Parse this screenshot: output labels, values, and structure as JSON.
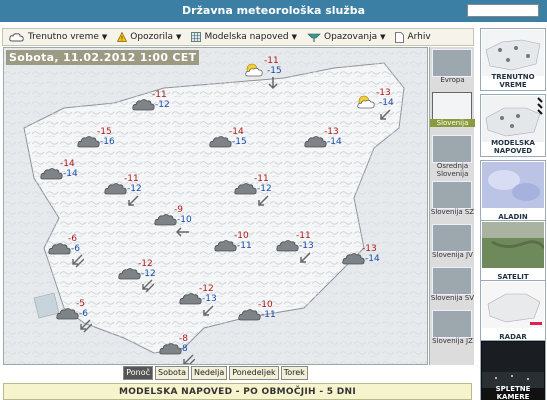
{
  "header": {
    "title": "Državna meteorološka služba",
    "colors": {
      "bar": "#3c7fa5",
      "text": "#ffffff"
    }
  },
  "menu": {
    "items": [
      {
        "label": "Trenutno vreme",
        "icon": "cloud-outline-icon",
        "has_caret": true
      },
      {
        "label": "Opozorila",
        "icon": "warning-triangle-icon",
        "has_caret": true
      },
      {
        "label": "Modelska napoved",
        "icon": "grid-icon",
        "has_caret": true
      },
      {
        "label": "Opazovanja",
        "icon": "observation-station-icon",
        "has_caret": true
      },
      {
        "label": "Arhiv",
        "icon": "document-icon",
        "has_caret": false
      }
    ]
  },
  "map": {
    "date_label": "Sobota, 11.02.2012 1:00 CET",
    "stations": [
      {
        "name": "s1",
        "icon": "partly-cloudy-night-icon",
        "tmax": "-11",
        "tmin": "-15",
        "wind": "south"
      },
      {
        "name": "s2",
        "icon": "cloudy-icon",
        "tmax": "-11",
        "tmin": "-12",
        "wind": ""
      },
      {
        "name": "s3",
        "icon": "partly-cloudy-night-icon",
        "tmax": "-13",
        "tmin": "-14",
        "wind": "southwest"
      },
      {
        "name": "s4",
        "icon": "cloudy-icon",
        "tmax": "-15",
        "tmin": "-16",
        "wind": ""
      },
      {
        "name": "s5",
        "icon": "cloudy-icon",
        "tmax": "-14",
        "tmin": "-15",
        "wind": ""
      },
      {
        "name": "s6",
        "icon": "cloudy-icon",
        "tmax": "-13",
        "tmin": "-14",
        "wind": ""
      },
      {
        "name": "s7",
        "icon": "cloudy-icon",
        "tmax": "-14",
        "tmin": "-14",
        "wind": ""
      },
      {
        "name": "s8",
        "icon": "cloudy-icon",
        "tmax": "-11",
        "tmin": "-12",
        "wind": "southwest"
      },
      {
        "name": "s9",
        "icon": "cloudy-icon",
        "tmax": "-11",
        "tmin": "-12",
        "wind": "southwest"
      },
      {
        "name": "s10",
        "icon": "cloudy-icon",
        "tmax": "-9",
        "tmin": "-10",
        "wind": "west"
      },
      {
        "name": "s11",
        "icon": "cloudy-icon",
        "tmax": "-6",
        "tmin": "-6",
        "wind": "southwest-double"
      },
      {
        "name": "s12",
        "icon": "cloudy-icon",
        "tmax": "-10",
        "tmin": "-11",
        "wind": ""
      },
      {
        "name": "s13",
        "icon": "cloudy-icon",
        "tmax": "-11",
        "tmin": "-13",
        "wind": "southwest"
      },
      {
        "name": "s14",
        "icon": "cloudy-icon",
        "tmax": "-13",
        "tmin": "-14",
        "wind": ""
      },
      {
        "name": "s15",
        "icon": "cloudy-icon",
        "tmax": "-12",
        "tmin": "-12",
        "wind": "southwest-double"
      },
      {
        "name": "s16",
        "icon": "cloudy-icon",
        "tmax": "-12",
        "tmin": "-13",
        "wind": "southwest"
      },
      {
        "name": "s17",
        "icon": "cloudy-icon",
        "tmax": "-5",
        "tmin": "-6",
        "wind": "southwest-double"
      },
      {
        "name": "s18",
        "icon": "cloudy-icon",
        "tmax": "-10",
        "tmin": "-11",
        "wind": ""
      },
      {
        "name": "s19",
        "icon": "cloudy-icon",
        "tmax": "-8",
        "tmin": "8",
        "wind": "southwest-double"
      }
    ]
  },
  "day_tabs": [
    {
      "label": "Ponoč",
      "active": true
    },
    {
      "label": "Sobota",
      "active": false
    },
    {
      "label": "Nedelja",
      "active": false
    },
    {
      "label": "Ponedeljek",
      "active": false
    },
    {
      "label": "Torek",
      "active": false
    }
  ],
  "banner": {
    "text": "MODELSKA NAPOVED - PO OBMOČJIH - 5 DNI"
  },
  "regions": [
    {
      "label": "Evropa",
      "active": false
    },
    {
      "label": "Slovenija",
      "active": true
    },
    {
      "label": "Osrednja Slovenija",
      "active": false
    },
    {
      "label": "Slovenija SZ",
      "active": false
    },
    {
      "label": "Slovenija JV",
      "active": false
    },
    {
      "label": "Slovenija SV",
      "active": false
    },
    {
      "label": "Slovenija JZ",
      "active": false
    }
  ],
  "right_panels": [
    {
      "label": "TRENUTNO VREME",
      "thumb": "weather-map-thumbnail"
    },
    {
      "label": "MODELSKA NAPOVED",
      "thumb": "forecast-map-thumbnail"
    },
    {
      "label": "ALADIN",
      "thumb": "aladin-model-thumbnail"
    },
    {
      "label": "SATELIT",
      "thumb": "satellite-thumbnail"
    },
    {
      "label": "RADAR",
      "thumb": "radar-thumbnail"
    },
    {
      "label": "SPLETNE KAMERE",
      "thumb": "webcam-thumbnail"
    }
  ],
  "search": {
    "placeholder": ""
  },
  "colors": {
    "tmax": "#b01818",
    "tmin": "#1a4aa8",
    "active_region": "#8c9a3e",
    "banner_bg": "#f6f4cd"
  }
}
